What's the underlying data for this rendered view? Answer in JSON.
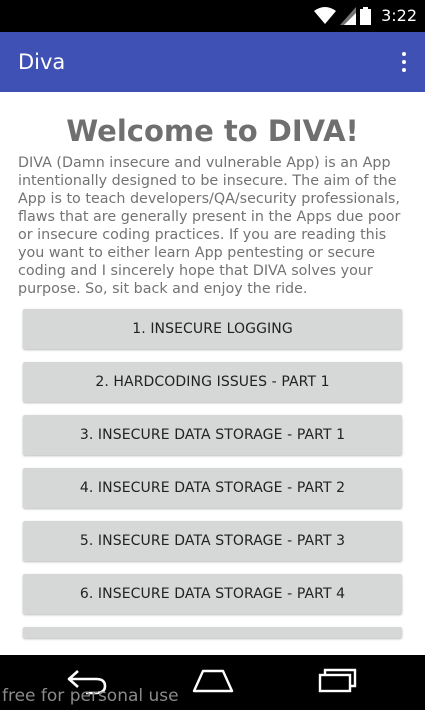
{
  "status_bar": {
    "time": "3:22",
    "icons": [
      "wifi-icon",
      "signal-icon",
      "battery-icon"
    ]
  },
  "app_bar": {
    "title": "Diva",
    "overflow_icon": "more-vert-icon",
    "color": "#3f51b5"
  },
  "content": {
    "heading": "Welcome to DIVA!",
    "intro": "DIVA (Damn insecure and vulnerable App) is an App intentionally designed to be insecure. The aim of the App is to teach developers/QA/security professionals, flaws that are generally present in the Apps due poor or insecure coding practices. If you are reading this you want to either learn App pentesting or secure coding and I sincerely hope that DIVA solves your purpose. So, sit back and enjoy the ride.",
    "buttons": [
      {
        "label": "1. INSECURE LOGGING"
      },
      {
        "label": "2. HARDCODING ISSUES - PART 1"
      },
      {
        "label": "3. INSECURE DATA STORAGE - PART 1"
      },
      {
        "label": "4. INSECURE DATA STORAGE - PART 2"
      },
      {
        "label": "5. INSECURE DATA STORAGE - PART 3"
      },
      {
        "label": "6. INSECURE DATA STORAGE - PART 4"
      }
    ]
  },
  "nav_bar": {
    "icons": [
      "back-icon",
      "home-icon",
      "recents-icon"
    ]
  },
  "watermark": "free for personal use"
}
